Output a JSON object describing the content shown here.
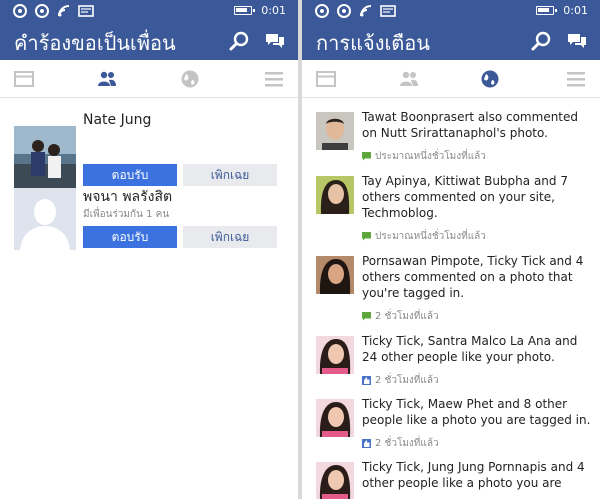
{
  "status": {
    "time": "0:01"
  },
  "left": {
    "title": "คำร้องขอเป็นเพื่อน",
    "requests": [
      {
        "name": "Nate Jung",
        "mutual": "",
        "confirm": "ตอบรับ",
        "ignore": "เพิกเฉย"
      },
      {
        "name": "พจนา พลรังสิต",
        "mutual": "มีเพื่อนร่วมกัน 1 คน",
        "confirm": "ตอบรับ",
        "ignore": "เพิกเฉย"
      }
    ]
  },
  "right": {
    "title": "การแจ้งเตือน",
    "notifications": [
      {
        "text": "Tawat Boonprasert also commented on Nutt Srirattanaphol's photo.",
        "time": "ประมาณหนึ่งชั่วโมงที่แล้ว",
        "kind": "comment"
      },
      {
        "text": "Tay Apinya, Kittiwat Bubpha and 7 others commented on your site, Techmoblog.",
        "time": "ประมาณหนึ่งชั่วโมงที่แล้ว",
        "kind": "comment"
      },
      {
        "text": "Pornsawan Pimpote, Ticky Tick and 4 others commented on a photo that you're tagged in.",
        "time": "2 ชั่วโมงที่แล้ว",
        "kind": "comment"
      },
      {
        "text": "Ticky Tick, Santra Malco La Ana and 24 other people like your photo.",
        "time": "2 ชั่วโมงที่แล้ว",
        "kind": "like"
      },
      {
        "text": "Ticky Tick, Maew Phet and 8 other people like a photo you are tagged in.",
        "time": "2 ชั่วโมงที่แล้ว",
        "kind": "like"
      },
      {
        "text": "Ticky Tick, Jung Jung Pornnapis and 4 other people like a photo you are",
        "time": "",
        "kind": "like"
      }
    ]
  },
  "colors": {
    "brand": "#3b5998",
    "confirm": "#3b72e0",
    "ignore_bg": "#e9eaed",
    "comment_icon": "#5fa83f",
    "like_icon": "#4a72c8"
  }
}
